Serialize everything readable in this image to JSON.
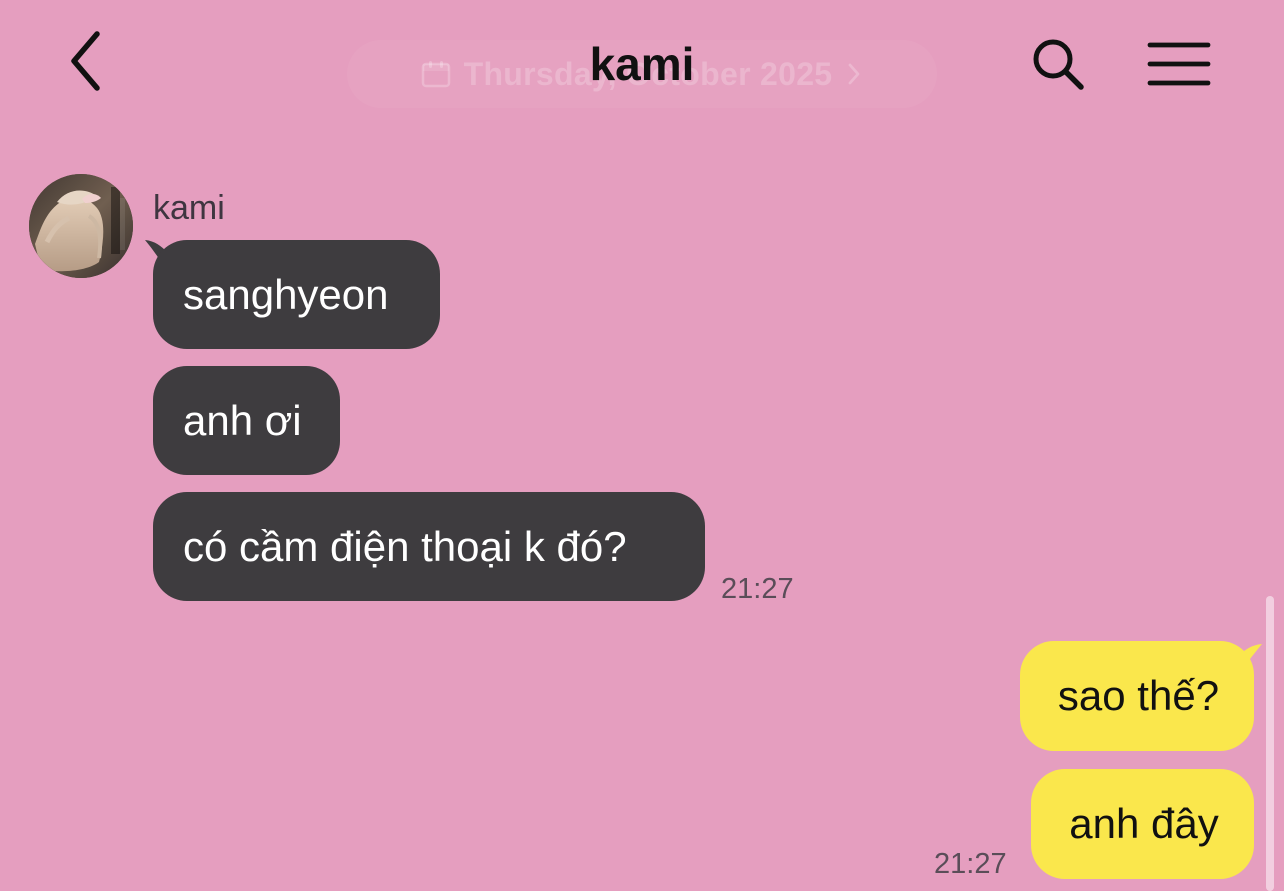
{
  "header": {
    "title": "kami",
    "date_label": "Thursday, October 2025",
    "back_icon": "chevron-left-icon",
    "search_icon": "search-icon",
    "menu_icon": "menu-icon"
  },
  "conversation": {
    "incoming": {
      "sender": "kami",
      "messages": [
        "sanghyeon",
        "anh ơi",
        "có cầm điện thoại k đó?"
      ],
      "time": "21:27"
    },
    "outgoing": {
      "messages": [
        "sao thế?",
        "anh đây"
      ],
      "time": "21:27"
    }
  },
  "colors": {
    "background": "#e59ebf",
    "incoming_bubble": "#3e3c3f",
    "outgoing_bubble": "#fae74c",
    "incoming_text": "#ffffff",
    "outgoing_text": "#111111"
  }
}
